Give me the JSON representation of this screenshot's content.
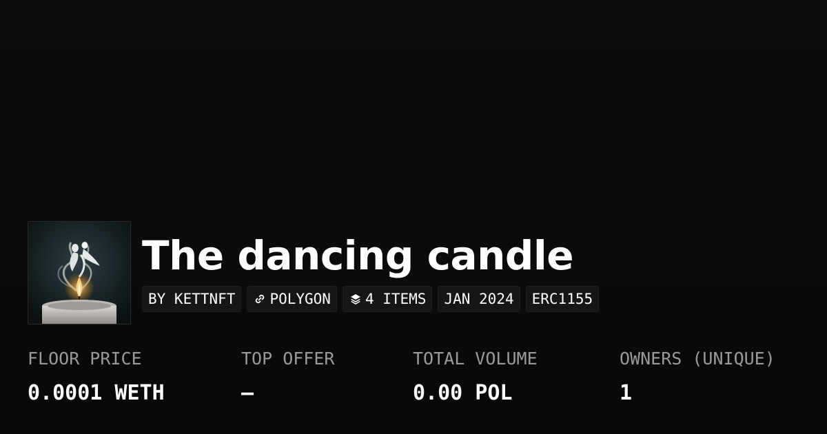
{
  "collection": {
    "title": "The dancing candle",
    "thumbnail_alt": "candle with dancing smoke figures artwork"
  },
  "tags": [
    {
      "label": "BY KETTNFT",
      "icon": ""
    },
    {
      "label": "POLYGON",
      "icon": "chain-link-icon"
    },
    {
      "label": "4 ITEMS",
      "icon": "layers-icon"
    },
    {
      "label": "JAN 2024",
      "icon": ""
    },
    {
      "label": "ERC1155",
      "icon": ""
    }
  ],
  "stats": [
    {
      "label": "FLOOR PRICE",
      "value": "0.0001 WETH"
    },
    {
      "label": "TOP OFFER",
      "value": "—"
    },
    {
      "label": "TOTAL VOLUME",
      "value": "0.00 POL"
    },
    {
      "label": "OWNERS (UNIQUE)",
      "value": "1"
    }
  ],
  "colors": {
    "background": "#0c0c0c",
    "text": "#ffffff",
    "label": "#9a9a9a",
    "tag_bg": "#161616"
  }
}
